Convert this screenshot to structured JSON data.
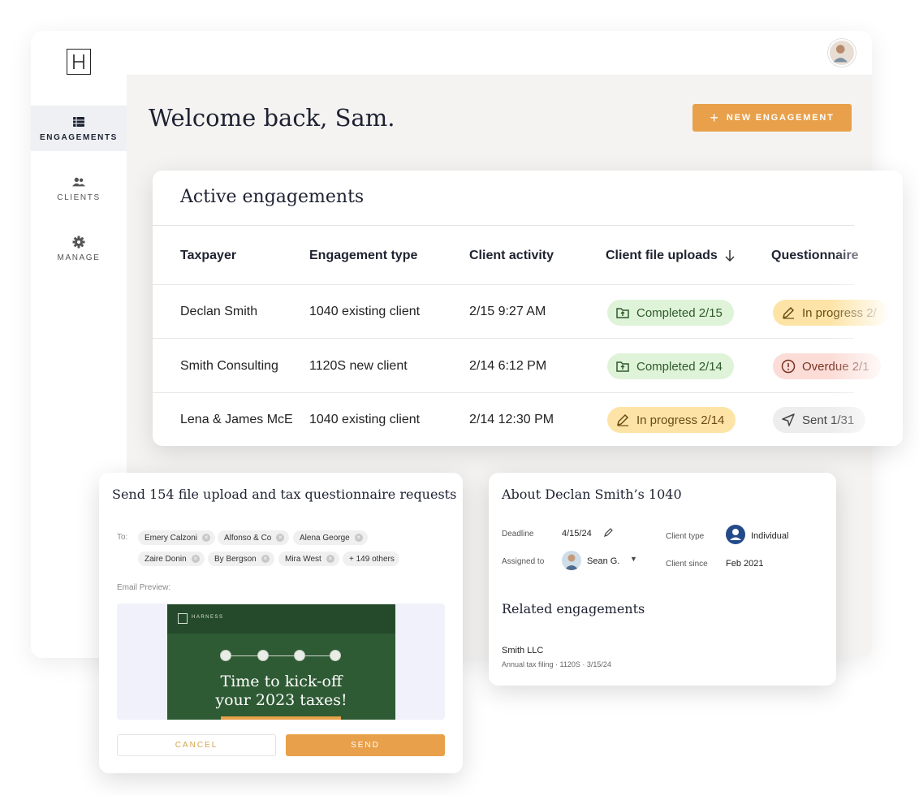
{
  "nav": {
    "items": [
      {
        "label": "ENGAGEMENTS",
        "icon": "table-list-icon"
      },
      {
        "label": "CLIENTS",
        "icon": "users-icon"
      },
      {
        "label": "MANAGE",
        "icon": "gear-icon"
      }
    ]
  },
  "header": {
    "welcome": "Welcome back, Sam.",
    "new_engagement_label": "NEW ENGAGEMENT",
    "accent_color": "#e8a04a"
  },
  "engagements": {
    "title": "Active engagements",
    "columns": [
      "Taxpayer",
      "Engagement type",
      "Client activity",
      "Client file uploads",
      "Questionnaire"
    ],
    "rows": [
      {
        "taxpayer": "Declan Smith",
        "type": "1040 existing client",
        "activity": "2/15 9:27 AM",
        "uploads": "Completed 2/15",
        "questionnaire": "In progress 2/"
      },
      {
        "taxpayer": "Smith Consulting",
        "type": "1120S new client",
        "activity": "2/14 6:12 PM",
        "uploads": "Completed 2/14",
        "questionnaire": "Overdue 2/1"
      },
      {
        "taxpayer": "Lena & James McE",
        "type": "1040 existing client",
        "activity": "2/14 12:30 PM",
        "uploads": "In progress 2/14",
        "questionnaire": "Sent 1/31"
      }
    ]
  },
  "send": {
    "title": "Send 154 file upload and tax questionnaire requests",
    "to_label": "To:",
    "recipients": [
      "Emery Calzoni",
      "Alfonso & Co",
      "Alena George",
      "Zaire Donin",
      "By Bergson",
      "Mira West"
    ],
    "more_recipients": "+ 149 others",
    "email_preview_label": "Email Preview:",
    "email": {
      "brand": "HARNESS",
      "headline_line1": "Time to kick-off",
      "headline_line2": "your 2023 taxes!"
    },
    "cancel_label": "CANCEL",
    "send_label": "SEND"
  },
  "about": {
    "title": "About Declan Smith’s 1040",
    "deadline_label": "Deadline",
    "deadline_value": "4/15/24",
    "assigned_label": "Assigned to",
    "assigned_value": "Sean G.",
    "client_type_label": "Client type",
    "client_type_value": "Individual",
    "client_since_label": "Client since",
    "client_since_value": "Feb 2021",
    "related_title": "Related engagements",
    "related": [
      {
        "name": "Smith LLC",
        "meta": "Annual tax filing · 1120S · 3/15/24"
      }
    ]
  }
}
